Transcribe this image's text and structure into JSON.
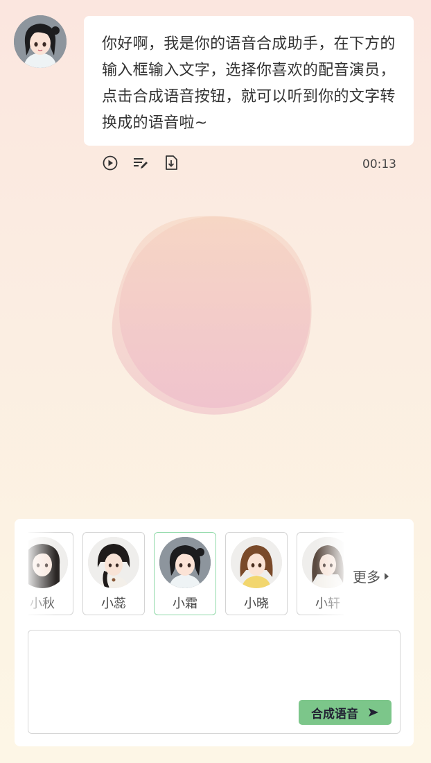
{
  "assistant": {
    "avatar_icon": "girl-avatar-icon",
    "message": "你好啊，我是你的语音合成助手，在下方的输入框输入文字，选择你喜欢的配音演员，点击合成语音按钮，就可以听到你的文字转换成的语音啦~",
    "actions": {
      "play_icon": "play-circle-icon",
      "edit_icon": "edit-text-icon",
      "download_icon": "download-file-icon"
    },
    "duration": "00:13"
  },
  "voices": [
    {
      "name": "小秋",
      "selected": false
    },
    {
      "name": "小蕊",
      "selected": false
    },
    {
      "name": "小霜",
      "selected": true
    },
    {
      "name": "小晓",
      "selected": false
    },
    {
      "name": "小轩",
      "selected": false
    }
  ],
  "more_label": "更多",
  "input": {
    "placeholder": "",
    "value": ""
  },
  "synthesize_button": {
    "label": "合成语音",
    "icon": "send-arrow-icon"
  },
  "colors": {
    "accent_green": "#7cc68a",
    "selected_border": "#8fd9a8",
    "blob_pink": "#f1c3cc",
    "blob_peach": "#f8d9c4"
  }
}
